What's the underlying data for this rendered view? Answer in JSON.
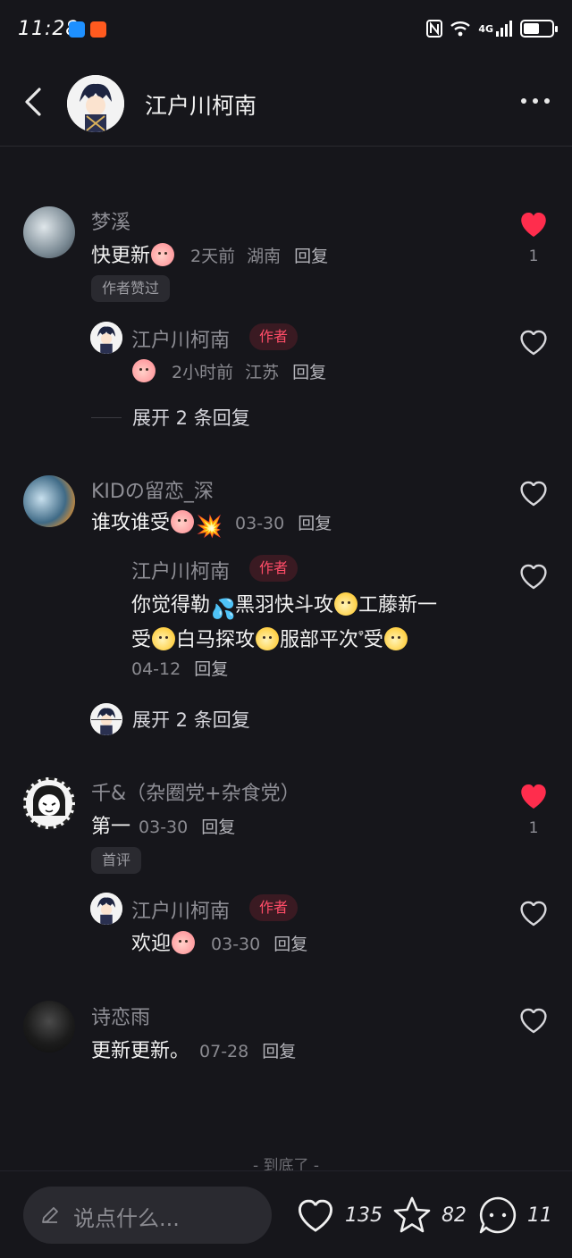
{
  "status_bar": {
    "time": "11:28",
    "network": "4G",
    "battery_level": 0.55
  },
  "header": {
    "title": "江户川柯南",
    "back_icon": "chevron-left-icon",
    "more_icon": "more-horizontal-icon"
  },
  "comments": [
    {
      "user": "梦溪",
      "text": "快更新",
      "time": "2天前",
      "location": "湖南",
      "reply_label": "回复",
      "tag": "作者赞过",
      "liked": true,
      "like_count": "1",
      "reply": {
        "user": "江户川柯南",
        "badge": "作者",
        "text": "",
        "time": "2小时前",
        "location": "江苏",
        "reply_label": "回复"
      },
      "expand_label": "展开 2 条回复"
    },
    {
      "user": "KIDの留恋_深",
      "text": "谁攻谁受",
      "time": "03-30",
      "reply_label": "回复",
      "liked": false,
      "reply": {
        "user": "江户川柯南",
        "badge": "作者",
        "line1": [
          "你觉得勒",
          "黑羽快斗攻",
          "工藤新一"
        ],
        "line2": [
          "受",
          "白马探攻",
          "服部平次",
          "受"
        ],
        "time": "04-12",
        "reply_label": "回复"
      },
      "expand_label": "展开 2 条回复"
    },
    {
      "user": "千&（杂圈党+杂食党）",
      "text": "第一",
      "time": "03-30",
      "reply_label": "回复",
      "tag": "首评",
      "liked": true,
      "like_count": "1",
      "reply": {
        "user": "江户川柯南",
        "badge": "作者",
        "text": "欢迎",
        "time": "03-30",
        "reply_label": "回复"
      }
    },
    {
      "user": "诗恋雨",
      "text": "更新更新。",
      "time": "07-28",
      "reply_label": "回复",
      "liked": false
    }
  ],
  "footer_end": "- 到底了 -",
  "bottom_bar": {
    "input_placeholder": "说点什么...",
    "likes": "135",
    "stars": "82",
    "comments": "11"
  },
  "colors": {
    "background": "#16161b",
    "heart_liked": "#ff2d4d",
    "author_badge": "#ff4d68"
  }
}
